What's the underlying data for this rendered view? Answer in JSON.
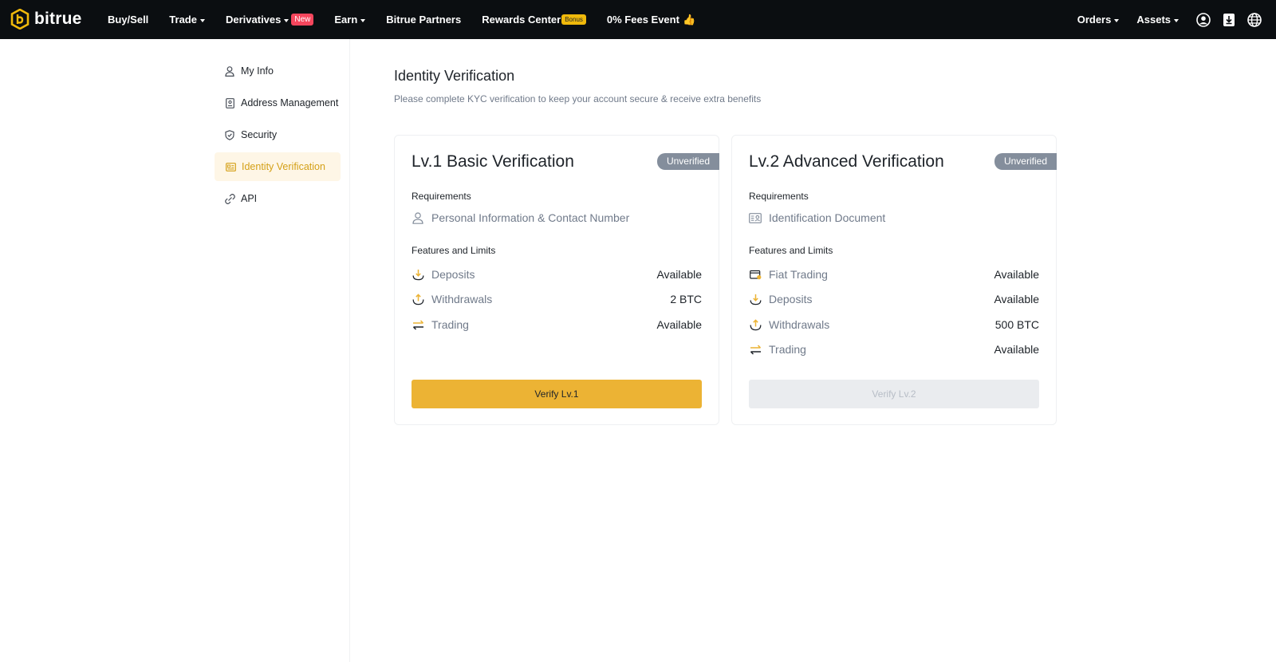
{
  "nav": {
    "logo_text": "bitrue",
    "items": [
      {
        "label": "Buy/Sell",
        "dropdown": false
      },
      {
        "label": "Trade",
        "dropdown": true
      },
      {
        "label": "Derivatives",
        "dropdown": true,
        "badge": "New"
      },
      {
        "label": "Earn",
        "dropdown": true
      },
      {
        "label": "Bitrue Partners",
        "dropdown": false
      },
      {
        "label": "Rewards Center",
        "dropdown": false,
        "badge": "Bonus"
      },
      {
        "label": "0% Fees Event",
        "dropdown": false,
        "emoji": "👍"
      }
    ],
    "right_items": [
      {
        "label": "Orders",
        "dropdown": true
      },
      {
        "label": "Assets",
        "dropdown": true
      }
    ],
    "right_icons": [
      "user-profile-icon",
      "download-icon",
      "globe-icon"
    ]
  },
  "sidebar": {
    "items": [
      {
        "label": "My Info",
        "icon": "user-icon",
        "active": false
      },
      {
        "label": "Address Management",
        "icon": "address-book-icon",
        "active": false
      },
      {
        "label": "Security",
        "icon": "shield-icon",
        "active": false
      },
      {
        "label": "Identity Verification",
        "icon": "id-card-icon",
        "active": true
      },
      {
        "label": "API",
        "icon": "api-link-icon",
        "active": false
      }
    ]
  },
  "main": {
    "title": "Identity Verification",
    "subtitle": "Please complete KYC verification to keep your account secure & receive extra benefits",
    "cards": [
      {
        "title": "Lv.1 Basic Verification",
        "status": "Unverified",
        "requirements_label": "Requirements",
        "requirements": [
          {
            "label": "Personal Information & Contact Number",
            "icon": "person-icon"
          }
        ],
        "features_label": "Features and Limits",
        "features": [
          {
            "label": "Deposits",
            "value": "Available",
            "icon": "deposit-icon"
          },
          {
            "label": "Withdrawals",
            "value": "2 BTC",
            "icon": "withdraw-icon"
          },
          {
            "label": "Trading",
            "value": "Available",
            "icon": "trading-icon"
          }
        ],
        "button_label": "Verify Lv.1",
        "button_enabled": true
      },
      {
        "title": "Lv.2 Advanced Verification",
        "status": "Unverified",
        "requirements_label": "Requirements",
        "requirements": [
          {
            "label": "Identification Document",
            "icon": "id-document-icon"
          }
        ],
        "features_label": "Features and Limits",
        "features": [
          {
            "label": "Fiat Trading",
            "value": "Available",
            "icon": "fiat-trading-icon"
          },
          {
            "label": "Deposits",
            "value": "Available",
            "icon": "deposit-icon"
          },
          {
            "label": "Withdrawals",
            "value": "500 BTC",
            "icon": "withdraw-icon"
          },
          {
            "label": "Trading",
            "value": "Available",
            "icon": "trading-icon"
          }
        ],
        "button_label": "Verify Lv.2",
        "button_enabled": false
      }
    ]
  },
  "colors": {
    "accent": "#ecb334",
    "nav_bg": "#0b0e11",
    "badge_new": "#f6465d",
    "badge_bonus": "#f0b90b",
    "status_badge": "#848e9c",
    "active_sidebar_bg": "#fef6e6",
    "active_sidebar_text": "#d4a017"
  }
}
